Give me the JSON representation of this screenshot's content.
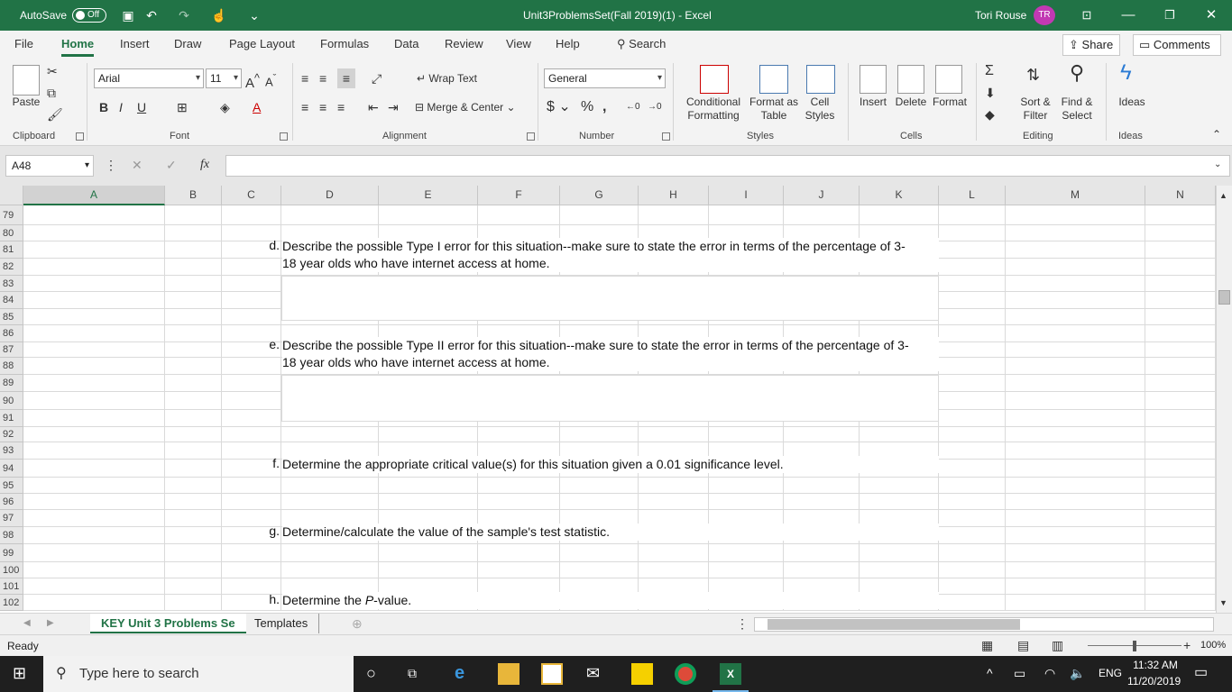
{
  "titlebar": {
    "autosave_label": "AutoSave",
    "autosave_state": "Off",
    "doc_title": "Unit3ProblemsSet(Fall 2019)(1)  -  Excel",
    "user_name": "Tori Rouse",
    "user_initials": "TR"
  },
  "tabs": [
    "File",
    "Home",
    "Insert",
    "Draw",
    "Page Layout",
    "Formulas",
    "Data",
    "Review",
    "View",
    "Help"
  ],
  "search_label": "Search",
  "share_label": "Share",
  "comments_label": "Comments",
  "ribbon": {
    "clipboard": {
      "paste": "Paste",
      "label": "Clipboard"
    },
    "font": {
      "name": "Arial",
      "size": "11",
      "label": "Font"
    },
    "alignment": {
      "wrap": "Wrap Text",
      "merge": "Merge & Center",
      "label": "Alignment"
    },
    "number": {
      "format": "General",
      "label": "Number"
    },
    "styles": {
      "conditional": "Conditional",
      "conditional2": "Formatting",
      "format_as": "Format as",
      "format_as2": "Table",
      "cell": "Cell",
      "cell2": "Styles",
      "label": "Styles"
    },
    "cells": {
      "insert": "Insert",
      "delete": "Delete",
      "format": "Format",
      "label": "Cells"
    },
    "editing": {
      "sort": "Sort &",
      "sort2": "Filter",
      "find": "Find &",
      "find2": "Select",
      "label": "Editing"
    },
    "ideas": {
      "button": "Ideas",
      "label": "Ideas"
    }
  },
  "formula_bar": {
    "name_box": "A48",
    "fx": "fx",
    "value": ""
  },
  "columns": [
    "A",
    "B",
    "C",
    "D",
    "E",
    "F",
    "G",
    "H",
    "I",
    "J",
    "K",
    "L",
    "M",
    "N"
  ],
  "rows": [
    "79",
    "80",
    "81",
    "82",
    "83",
    "84",
    "85",
    "86",
    "87",
    "88",
    "89",
    "90",
    "91",
    "92",
    "93",
    "94",
    "95",
    "96",
    "97",
    "98",
    "99",
    "100",
    "101",
    "102"
  ],
  "questions": [
    {
      "letter": "d.",
      "line1": "Describe the possible Type I error for this situation--make sure to state the error in terms of the percentage of 3-",
      "line2": "18 year olds who have internet access at home."
    },
    {
      "letter": "e.",
      "line1": "Describe the possible Type II error for this situation--make sure to state the error in terms of the percentage of 3-",
      "line2": "18 year olds who have internet access at home."
    },
    {
      "letter": "f.",
      "line1": "Determine the appropriate critical value(s) for this situation given a 0.01 significance level."
    },
    {
      "letter": "g.",
      "line1": "Determine/calculate the value of the sample's test statistic."
    },
    {
      "letter": "h.",
      "line1_pre": "Determine the ",
      "line1_em": "P",
      "line1_post": "-value."
    }
  ],
  "sheets": [
    "KEY Unit 3 Problems Se",
    "Templates"
  ],
  "status": {
    "ready": "Ready",
    "zoom": "100%"
  },
  "taskbar": {
    "search_placeholder": "Type here to search",
    "lang": "ENG",
    "time": "11:32 AM",
    "date": "11/20/2019"
  }
}
